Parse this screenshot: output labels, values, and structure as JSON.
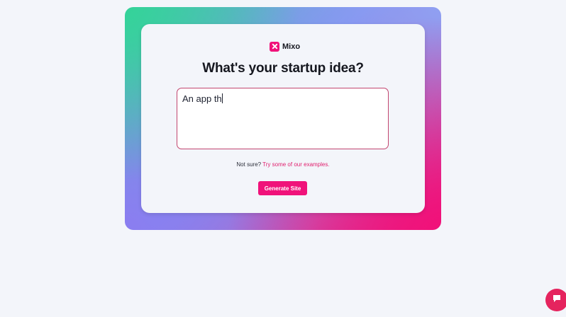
{
  "brand": {
    "name": "Mixo",
    "icon": "x-logo-icon",
    "color": "#f0127a"
  },
  "hero": {
    "title": "What's your startup idea?"
  },
  "idea_input": {
    "value": "An app th",
    "placeholder": ""
  },
  "hint": {
    "prefix": "Not sure?",
    "link_label": "Try some of our examples."
  },
  "actions": {
    "generate_label": "Generate Site"
  },
  "chat": {
    "icon": "chat-bubble-icon"
  },
  "colors": {
    "accent": "#f0127a",
    "input_border": "#c2456f",
    "background": "#f3f5fa"
  }
}
